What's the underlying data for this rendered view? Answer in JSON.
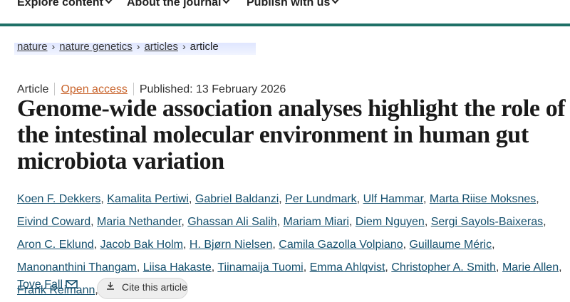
{
  "nav": {
    "items": [
      {
        "label": "Explore content"
      },
      {
        "label": "About the journal"
      },
      {
        "label": "Publish with us"
      }
    ]
  },
  "breadcrumb": [
    "nature",
    "nature genetics",
    "articles",
    "article"
  ],
  "meta": {
    "type": "Article",
    "access": "Open access",
    "published": "Published: 13 February 2026"
  },
  "title": "Genome-wide association analyses highlight the role of the intestinal molecular environment in human gut microbiota variation",
  "authors": [
    "Koen F. Dekkers",
    "Kamalita Pertiwi",
    "Gabriel Baldanzi",
    "Per Lundmark",
    "Ulf Hammar",
    "Marta Riise Moksnes",
    "Eivind Coward",
    "Maria Nethander",
    "Ghassan Ali Salih",
    "Mariam Miari",
    "Diem Nguyen",
    "Sergi Sayols-Baixeras",
    "Aron C. Eklund",
    "Jacob Bak Holm",
    "H. Bjørn Nielsen",
    "Camila Gazolla Volpiano",
    "Guillaume Méric",
    "Manonanthini Thangam",
    "Liisa Hakaste",
    "Tiinamaija Tuomi",
    "Emma Ahlqvist",
    "Christopher A. Smith",
    "Marie Allen",
    "Frank Reimann"
  ],
  "last_author": "Tove Fall",
  "cite_label": "Cite this article",
  "colors": {
    "brand_rule": "#1e7067",
    "author_link": "#15506e",
    "open_access": "#c9642c"
  }
}
